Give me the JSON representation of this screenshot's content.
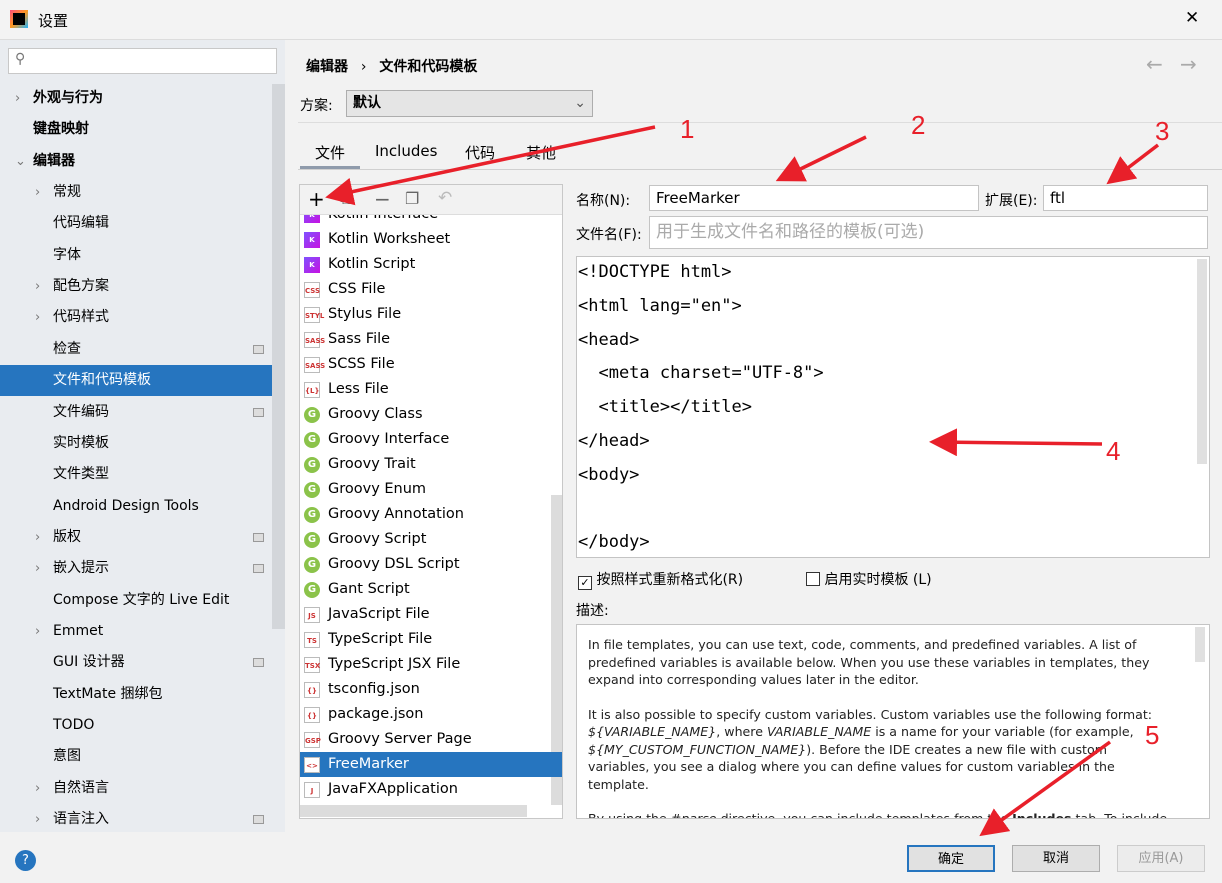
{
  "window": {
    "title": "设置",
    "close": "✕"
  },
  "sidebar": {
    "items": [
      {
        "label": "外观与行为",
        "bold": true,
        "chev": "›",
        "indent": 0
      },
      {
        "label": "键盘映射",
        "bold": true,
        "chev": "",
        "indent": 0
      },
      {
        "label": "编辑器",
        "bold": true,
        "chev": "⌄",
        "indent": 0
      },
      {
        "label": "常规",
        "chev": "›",
        "indent": 1
      },
      {
        "label": "代码编辑",
        "chev": "",
        "indent": 1
      },
      {
        "label": "字体",
        "chev": "",
        "indent": 1
      },
      {
        "label": "配色方案",
        "chev": "›",
        "indent": 1
      },
      {
        "label": "代码样式",
        "chev": "›",
        "indent": 1
      },
      {
        "label": "检查",
        "chev": "",
        "indent": 1,
        "gear": true
      },
      {
        "label": "文件和代码模板",
        "chev": "",
        "indent": 1,
        "selected": true
      },
      {
        "label": "文件编码",
        "chev": "",
        "indent": 1,
        "gear": true
      },
      {
        "label": "实时模板",
        "chev": "",
        "indent": 1
      },
      {
        "label": "文件类型",
        "chev": "",
        "indent": 1
      },
      {
        "label": "Android Design Tools",
        "chev": "",
        "indent": 1
      },
      {
        "label": "版权",
        "chev": "›",
        "indent": 1,
        "gear": true
      },
      {
        "label": "嵌入提示",
        "chev": "›",
        "indent": 1,
        "gear": true
      },
      {
        "label": "Compose 文字的 Live Edit",
        "chev": "",
        "indent": 1
      },
      {
        "label": "Emmet",
        "chev": "›",
        "indent": 1
      },
      {
        "label": "GUI 设计器",
        "chev": "",
        "indent": 1,
        "gear": true
      },
      {
        "label": "TextMate 捆绑包",
        "chev": "",
        "indent": 1
      },
      {
        "label": "TODO",
        "chev": "",
        "indent": 1
      },
      {
        "label": "意图",
        "chev": "",
        "indent": 1
      },
      {
        "label": "自然语言",
        "chev": "›",
        "indent": 1
      },
      {
        "label": "语言注入",
        "chev": "›",
        "indent": 1,
        "gear": true
      }
    ]
  },
  "breadcrumb": {
    "parent": "编辑器",
    "sep": "›",
    "current": "文件和代码模板"
  },
  "scheme": {
    "label": "方案:",
    "value": "默认"
  },
  "tabs": [
    "文件",
    "Includes",
    "代码",
    "其他"
  ],
  "toolbar": {
    "add": "+",
    "copy": "⧉",
    "remove": "−",
    "dup": "❐",
    "reset": "↶"
  },
  "files": [
    {
      "name": "Kotlin Interface",
      "icon": "K",
      "type": "k"
    },
    {
      "name": "Kotlin Worksheet",
      "icon": "K",
      "type": "k"
    },
    {
      "name": "Kotlin Script",
      "icon": "K",
      "type": "k"
    },
    {
      "name": "CSS File",
      "icon": "CSS",
      "type": "f"
    },
    {
      "name": "Stylus File",
      "icon": "STYL",
      "type": "f"
    },
    {
      "name": "Sass File",
      "icon": "SASS",
      "type": "f"
    },
    {
      "name": "SCSS File",
      "icon": "SASS",
      "type": "f"
    },
    {
      "name": "Less File",
      "icon": "{L}",
      "type": "f"
    },
    {
      "name": "Groovy Class",
      "icon": "G",
      "type": "g"
    },
    {
      "name": "Groovy Interface",
      "icon": "G",
      "type": "g"
    },
    {
      "name": "Groovy Trait",
      "icon": "G",
      "type": "g"
    },
    {
      "name": "Groovy Enum",
      "icon": "G",
      "type": "g"
    },
    {
      "name": "Groovy Annotation",
      "icon": "G",
      "type": "g"
    },
    {
      "name": "Groovy Script",
      "icon": "G",
      "type": "g"
    },
    {
      "name": "Groovy DSL Script",
      "icon": "G",
      "type": "g"
    },
    {
      "name": "Gant Script",
      "icon": "G",
      "type": "g"
    },
    {
      "name": "JavaScript File",
      "icon": "JS",
      "type": "f"
    },
    {
      "name": "TypeScript File",
      "icon": "TS",
      "type": "f"
    },
    {
      "name": "TypeScript JSX File",
      "icon": "TSX",
      "type": "f"
    },
    {
      "name": "tsconfig.json",
      "icon": "{}",
      "type": "f"
    },
    {
      "name": "package.json",
      "icon": "{}",
      "type": "f"
    },
    {
      "name": "Groovy Server Page",
      "icon": "GSP",
      "type": "f"
    },
    {
      "name": "FreeMarker",
      "icon": "<>",
      "type": "f",
      "selected": true
    },
    {
      "name": "JavaFXApplication",
      "icon": "J",
      "type": "f"
    }
  ],
  "form": {
    "name_label": "名称(N):",
    "name_value": "FreeMarker",
    "ext_label": "扩展(E):",
    "ext_value": "ftl",
    "filename_label": "文件名(F):",
    "filename_placeholder": "用于生成文件名和路径的模板(可选)"
  },
  "code": [
    "<!DOCTYPE html>",
    "<html lang=\"en\">",
    "<head>",
    "  <meta charset=\"UTF-8\">",
    "  <title></title>",
    "</head>",
    "<body>",
    "",
    "</body>"
  ],
  "options": {
    "reformat": "按照样式重新格式化(R)",
    "reformat_checked": true,
    "live": "启用实时模板 (L)",
    "live_checked": false
  },
  "desc": {
    "label": "描述:",
    "p1": "In file templates, you can use text, code, comments, and predefined variables. A list of predefined variables is available below. When you use these variables in templates, they expand into corresponding values later in the editor.",
    "p2a": "It is also possible to specify custom variables. Custom variables use the following format: ",
    "p2v1": "${VARIABLE_NAME}",
    "p2b": ", where ",
    "p2v2": "VARIABLE_NAME",
    "p2c": " is a name for your variable (for example, ",
    "p2v3": "${MY_CUSTOM_FUNCTION_NAME}",
    "p2d": "). Before the IDE creates a new file with custom variables, you see a dialog where you can define values for custom variables in the template.",
    "p3a": "By using the ",
    "p3v": "#parse",
    "p3b": " directive, you can include templates from the ",
    "p3c": "Includes",
    "p3d": " tab. To include a template, specify the full name of the template as a parameter in quotation marks (for"
  },
  "buttons": {
    "ok": "确定",
    "cancel": "取消",
    "apply": "应用(A)",
    "help": "?"
  },
  "annotations": [
    "1",
    "2",
    "3",
    "4",
    "5"
  ],
  "colors": {
    "accent": "#2675bf",
    "arrow": "#e8202a"
  }
}
